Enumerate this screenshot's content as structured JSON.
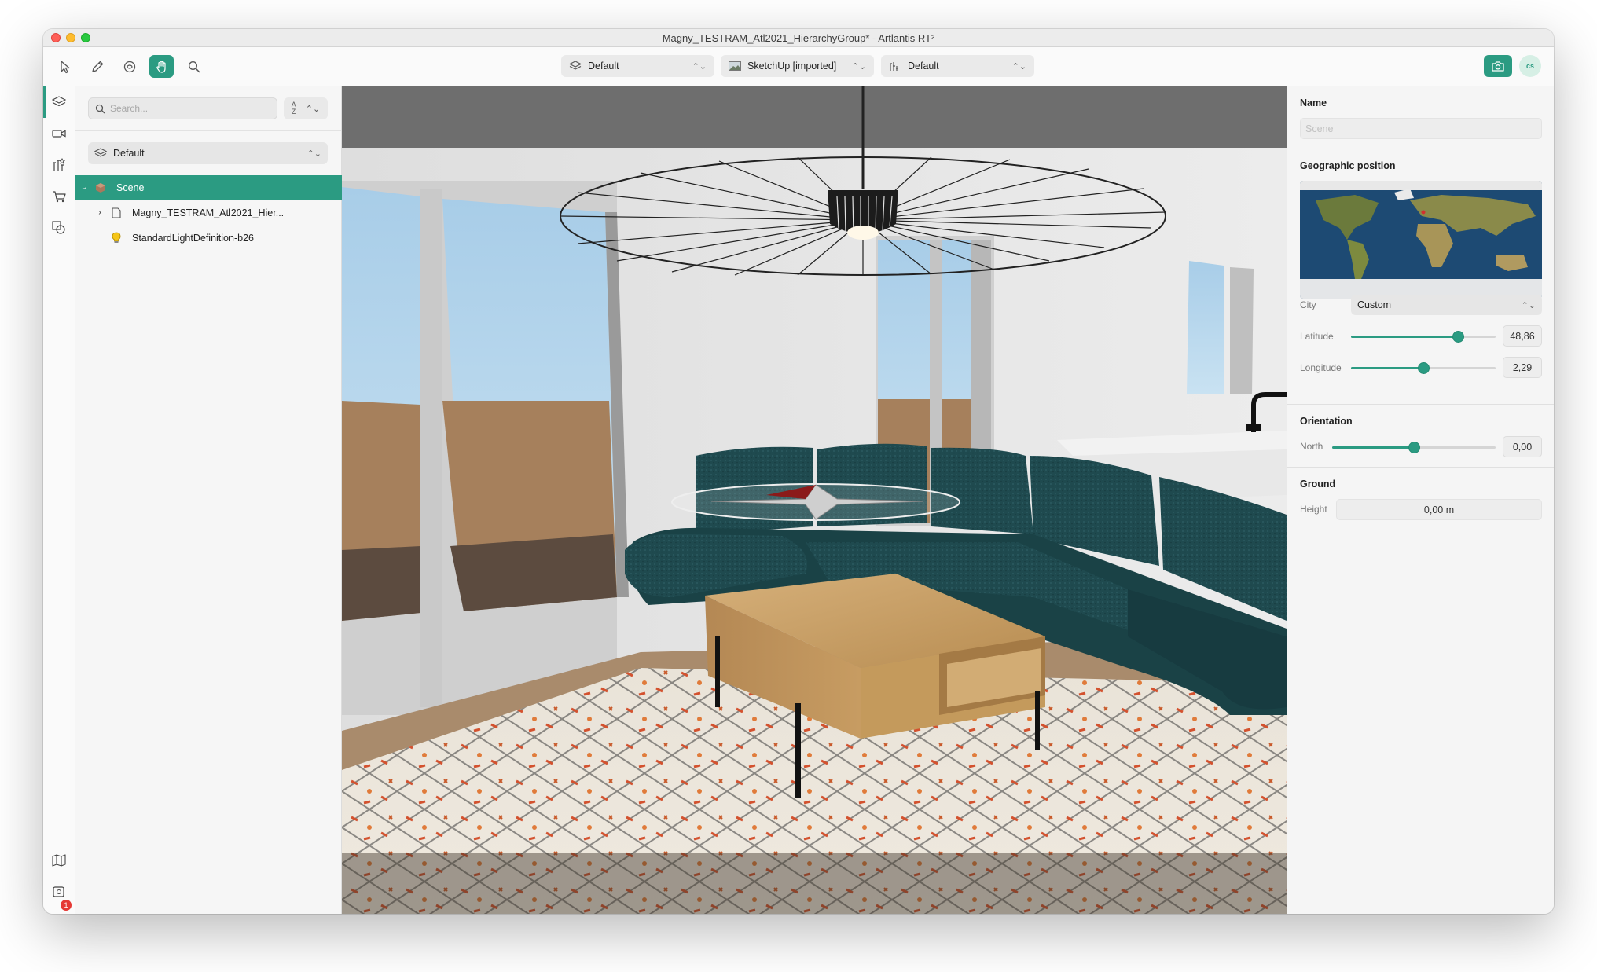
{
  "window": {
    "title": "Magny_TESTRAM_Atl2021_HierarchyGroup* - Artlantis RT²"
  },
  "toolbar": {
    "tools": [
      {
        "name": "select-tool",
        "icon": "arrow-pointer-icon"
      },
      {
        "name": "pencil-tool",
        "icon": "pencil-icon"
      },
      {
        "name": "orbit-tool",
        "icon": "orbit-icon"
      },
      {
        "name": "pan-tool",
        "icon": "hand-icon",
        "active": true
      },
      {
        "name": "zoom-tool",
        "icon": "magnifier-icon"
      }
    ],
    "layer_dropdown": "Default",
    "scene_dropdown": "SketchUp [imported]",
    "view_dropdown": "Default",
    "user_initials": "cs"
  },
  "left_rail": {
    "items": [
      "layers-icon",
      "camera-icon",
      "light-setting-icon",
      "cart-icon",
      "shaders-icon",
      "map-icon",
      "notification-icon",
      "activity-icon"
    ],
    "notification_count": "1"
  },
  "scene_panel": {
    "search_placeholder": "Search...",
    "sort_label": "A Z",
    "layer_filter": "Default",
    "tree": [
      {
        "label": "Scene",
        "level": 0,
        "expanded": true,
        "selected": true,
        "icon": "scene-cube-icon"
      },
      {
        "label": "Magny_TESTRAM_Atl2021_Hier...",
        "level": 1,
        "expanded": false,
        "selected": false,
        "icon": "document-icon"
      },
      {
        "label": "StandardLightDefinition-b26",
        "level": 1,
        "expanded": false,
        "selected": false,
        "icon": "light-bulb-icon"
      }
    ]
  },
  "inspector": {
    "name_section": {
      "title": "Name",
      "placeholder": "Scene"
    },
    "geo_section": {
      "title": "Geographic position",
      "city_label": "City",
      "city_value": "Custom",
      "latitude_label": "Latitude",
      "latitude_value": "48,86",
      "latitude_fraction": 0.74,
      "longitude_label": "Longitude",
      "longitude_value": "2,29",
      "longitude_fraction": 0.5
    },
    "orientation_section": {
      "title": "Orientation",
      "north_label": "North",
      "north_value": "0,00",
      "north_fraction": 0.5
    },
    "ground_section": {
      "title": "Ground",
      "height_label": "Height",
      "height_value": "0,00 m"
    }
  },
  "colors": {
    "accent": "#2b9b82",
    "badge": "#e53935",
    "sofa": "#1f4a4f",
    "table_wood": "#c49a5c"
  }
}
